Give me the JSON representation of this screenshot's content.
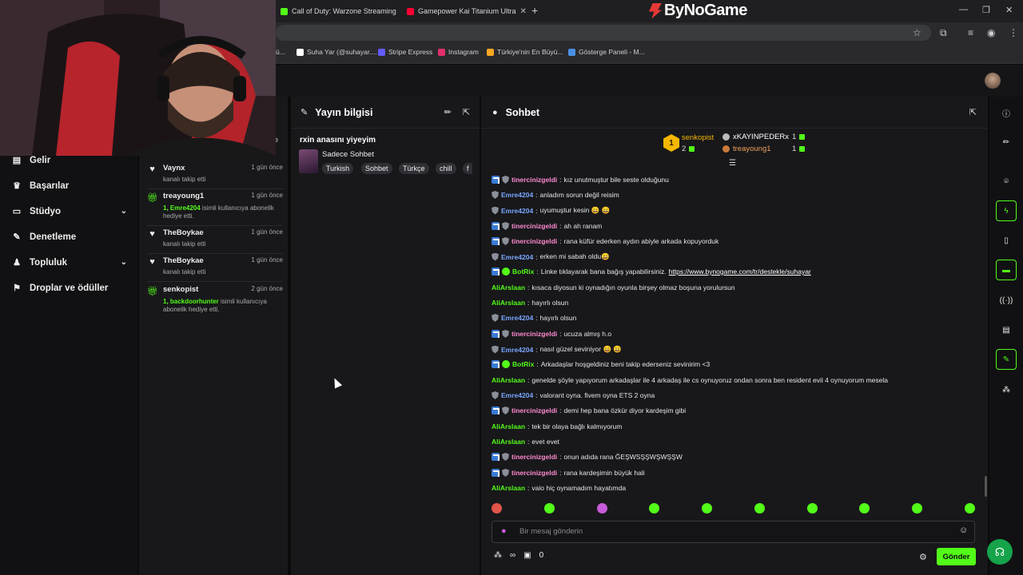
{
  "browser": {
    "tabs": [
      {
        "label": "Call of Duty: Warzone Streaming",
        "favicon_color": "#53fc18"
      },
      {
        "label": "Gamepower Kai Titanium Ultra",
        "favicon_color": "#ff0033"
      }
    ],
    "new_tab": "+",
    "brand": "ByNoGame",
    "bookmarks": [
      {
        "label": "ü...",
        "color": "#888888"
      },
      {
        "label": "Suha Yar (@suhayar....",
        "color": "#ffffff"
      },
      {
        "label": "Stripe Express",
        "color": "#635bff"
      },
      {
        "label": "Instagram",
        "color": "#e1306c"
      },
      {
        "label": "Türkiye'nin En Büyü...",
        "color": "#f5a623"
      },
      {
        "label": "Gösterge Paneli - M...",
        "color": "#4a90e2"
      }
    ]
  },
  "sidebar": {
    "items": [
      {
        "label": "Gelir",
        "icon": "money-icon",
        "glyph": "▤",
        "chevron": false
      },
      {
        "label": "Başarılar",
        "icon": "trophy-icon",
        "glyph": "♛",
        "chevron": false
      },
      {
        "label": "Stüdyo",
        "icon": "studio-icon",
        "glyph": "▭",
        "chevron": true
      },
      {
        "label": "Denetleme",
        "icon": "wrench-icon",
        "glyph": "✎",
        "chevron": false
      },
      {
        "label": "Topluluk",
        "icon": "people-icon",
        "glyph": "♟",
        "chevron": true
      },
      {
        "label": "Droplar ve ödüller",
        "icon": "drops-icon",
        "glyph": "⚑",
        "chevron": false
      }
    ]
  },
  "activity": {
    "partial_label": "e",
    "items": [
      {
        "name": "Vaynx",
        "time": "1 gün önce",
        "icon": "heart-icon",
        "desc": "kanalı takip etti",
        "highlight": "",
        "rest": ""
      },
      {
        "name": "treayoung1",
        "time": "1 gün önce",
        "icon": "gift-icon",
        "desc": "",
        "highlight": "1, Emre4204",
        "rest": " isimli kullanıcıya abonelik hediye etti."
      },
      {
        "name": "TheBoykae",
        "time": "1 gün önce",
        "icon": "heart-icon",
        "desc": "kanalı takip etti",
        "highlight": "",
        "rest": ""
      },
      {
        "name": "TheBoykae",
        "time": "1 gün önce",
        "icon": "heart-icon",
        "desc": "kanalı takip etti",
        "highlight": "",
        "rest": ""
      },
      {
        "name": "senkopist",
        "time": "2 gün önce",
        "icon": "gift-icon",
        "desc": "",
        "highlight": "1, backdoorhunter",
        "rest": " isimli kullanıcıya abonelik hediye etti."
      }
    ]
  },
  "stream_info": {
    "header": "Yayın bilgisi",
    "title": "rxin anasını yiyeyim",
    "category": "Sadece Sohbet",
    "tags": [
      "Turkish",
      "Sohbet",
      "Türkçe",
      "chill",
      "f"
    ]
  },
  "chat": {
    "header": "Sohbet",
    "leaderboard": {
      "rank1": {
        "rank": "1",
        "name": "senkopist",
        "count": "2"
      },
      "rank2": {
        "name": "xKAYINPEDERx",
        "count": "1"
      },
      "rank3": {
        "name": "treayoung1",
        "count": "1"
      }
    },
    "messages": [
      {
        "user": "tinercinizgeldi",
        "color": "#ff8ad0",
        "badges": [
          "mod",
          "shield"
        ],
        "text": "kız unutmuştur bile seste olduğunu"
      },
      {
        "user": "Emre4204",
        "color": "#7aa7ff",
        "badges": [
          "shield"
        ],
        "text": "anladım sorun değil reisim"
      },
      {
        "user": "Emre4204",
        "color": "#7aa7ff",
        "badges": [
          "shield"
        ],
        "text": "uyumuştur kesin 😄 😄"
      },
      {
        "user": "tinercinizgeldi",
        "color": "#ff8ad0",
        "badges": [
          "mod",
          "shield"
        ],
        "text": "ah ah ranam"
      },
      {
        "user": "tinercinizgeldi",
        "color": "#ff8ad0",
        "badges": [
          "mod",
          "shield"
        ],
        "text": "rana küfür ederken aydın abiyle arkada kopuyorduk"
      },
      {
        "user": "Emre4204",
        "color": "#7aa7ff",
        "badges": [
          "shield"
        ],
        "text": "erken mi sabah oldu😄"
      },
      {
        "user": "BotRix",
        "color": "#53fc18",
        "badges": [
          "mod",
          "ver"
        ],
        "text": "Linke tıklayarak bana bağış yapabilirsiniz. ",
        "link": "https://www.bynogame.com/tr/destekle/suhayar"
      },
      {
        "user": "AliArslaan",
        "color": "#53fc18",
        "badges": [],
        "text": "kısaca diyosun ki oynadığın oyunla birşey olmaz boşuna yorulursun"
      },
      {
        "user": "AliArslaan",
        "color": "#53fc18",
        "badges": [],
        "text": "hayırlı olsun"
      },
      {
        "user": "Emre4204",
        "color": "#7aa7ff",
        "badges": [
          "shield"
        ],
        "text": "hayırlı olsun"
      },
      {
        "user": "tinercinizgeldi",
        "color": "#ff8ad0",
        "badges": [
          "mod",
          "shield"
        ],
        "text": "ucuza almış h.o"
      },
      {
        "user": "Emre4204",
        "color": "#7aa7ff",
        "badges": [
          "shield"
        ],
        "text": "nasıl güzel seviniyor 😄 😄"
      },
      {
        "user": "BotRix",
        "color": "#53fc18",
        "badges": [
          "mod",
          "ver"
        ],
        "text": "Arkadaşlar hoşgeldiniz beni takip ederseniz sevinirim <3"
      },
      {
        "user": "AliArslaan",
        "color": "#53fc18",
        "badges": [],
        "text": "genelde şöyle yapıyorum arkadaşlar ile 4 arkadaş ile cs oynuyoruz ondan sonra ben resident evil 4 oynuyorum mesela"
      },
      {
        "user": "Emre4204",
        "color": "#7aa7ff",
        "badges": [
          "shield"
        ],
        "text": "valorant oyna. fivem oyna ETS 2 oyna"
      },
      {
        "user": "tinercinizgeldi",
        "color": "#ff8ad0",
        "badges": [
          "mod",
          "shield"
        ],
        "text": "demi hep bana özkür diyor kardeşim gibi"
      },
      {
        "user": "AliArslaan",
        "color": "#53fc18",
        "badges": [],
        "text": "tek bir olaya bağlı kalmıyorum"
      },
      {
        "user": "AliArslaan",
        "color": "#53fc18",
        "badges": [],
        "text": "evet evet"
      },
      {
        "user": "tinercinizgeldi",
        "color": "#ff8ad0",
        "badges": [
          "mod",
          "shield"
        ],
        "text": "onun adıda rana ĞEŞWSŞŞWŞWŞŞW"
      },
      {
        "user": "tinercinizgeldi",
        "color": "#ff8ad0",
        "badges": [
          "mod",
          "shield"
        ],
        "text": "rana kardeşimin büyük hali"
      },
      {
        "user": "AliArslaan",
        "color": "#53fc18",
        "badges": [],
        "text": "vaio hiç oynamadım hayatımda"
      }
    ],
    "emote_count": 10,
    "input_placeholder": "Bir mesaj gönderin",
    "points": "∞",
    "drops": "0",
    "send_label": "Gönder"
  },
  "right_rail": [
    "info-icon",
    "edit-icon",
    "camera-icon",
    "bolt-icon",
    "page-icon",
    "chat-icon",
    "broadcast-icon",
    "cart-icon",
    "tools-icon",
    "group-icon"
  ],
  "accent": "#53fc18"
}
